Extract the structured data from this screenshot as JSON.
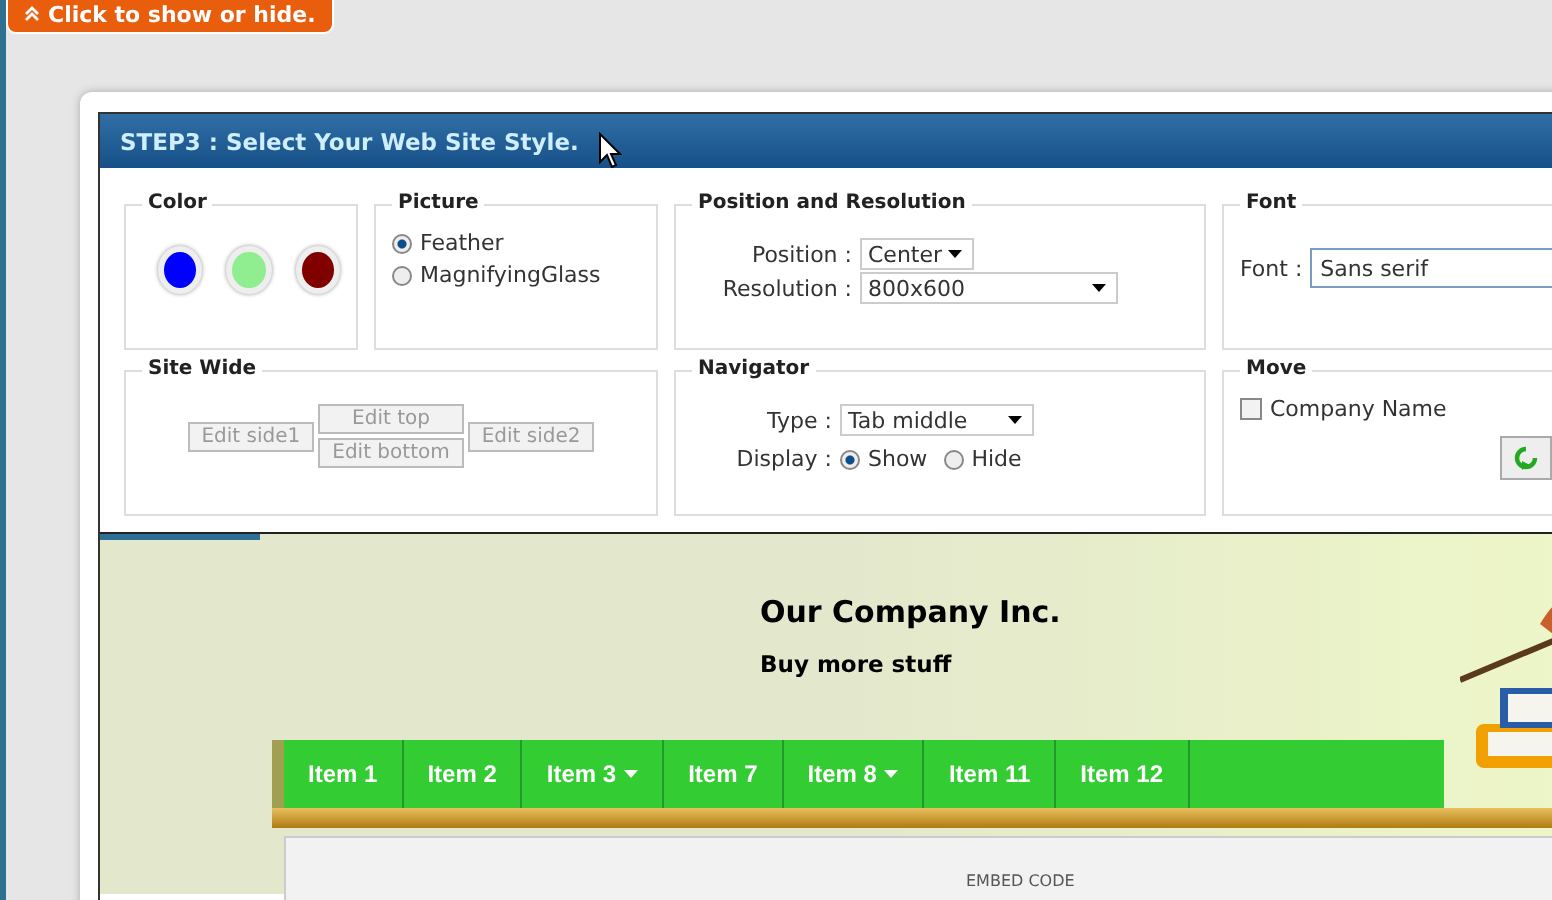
{
  "toggle": {
    "label": "Click to show or hide."
  },
  "step": {
    "title": "STEP3 : Select Your Web Site Style."
  },
  "color": {
    "legend": "Color",
    "swatches": [
      {
        "color": "#0000ff"
      },
      {
        "color": "#90ee90"
      },
      {
        "color": "#800000"
      }
    ]
  },
  "picture": {
    "legend": "Picture",
    "options": [
      {
        "label": "Feather",
        "selected": true
      },
      {
        "label": "MagnifyingGlass",
        "selected": false
      }
    ]
  },
  "position": {
    "legend": "Position and Resolution",
    "fields": [
      {
        "label": "Position :",
        "value": "Center",
        "kind": "short"
      },
      {
        "label": "Resolution :",
        "value": "800x600",
        "kind": "long"
      }
    ]
  },
  "font": {
    "legend": "Font",
    "label": "Font :",
    "value": "Sans serif"
  },
  "site_wide": {
    "legend": "Site Wide",
    "buttons": [
      {
        "label": "Edit side1",
        "disabled": true
      },
      {
        "label": "Edit top",
        "disabled": true
      },
      {
        "label": "Edit bottom",
        "disabled": true
      },
      {
        "label": "Edit side2",
        "disabled": true
      }
    ]
  },
  "navigator": {
    "legend": "Navigator",
    "type_label": "Type :",
    "type_value": "Tab middle",
    "display_label": "Display :",
    "options": [
      {
        "label": "Show",
        "selected": true
      },
      {
        "label": "Hide",
        "selected": false
      }
    ]
  },
  "move": {
    "legend": "Move",
    "checkbox": {
      "label": "Company Name",
      "checked": false
    }
  },
  "preview": {
    "company": "Our Company Inc.",
    "slogan": "Buy more stuff",
    "menu": [
      {
        "label": "Item 1",
        "submenu": false
      },
      {
        "label": "Item 2",
        "submenu": false
      },
      {
        "label": "Item 3",
        "submenu": true
      },
      {
        "label": "Item 7",
        "submenu": false
      },
      {
        "label": "Item 8",
        "submenu": true
      },
      {
        "label": "Item 11",
        "submenu": false
      },
      {
        "label": "Item 12",
        "submenu": false
      }
    ],
    "content_label": "EMBED CODE"
  }
}
